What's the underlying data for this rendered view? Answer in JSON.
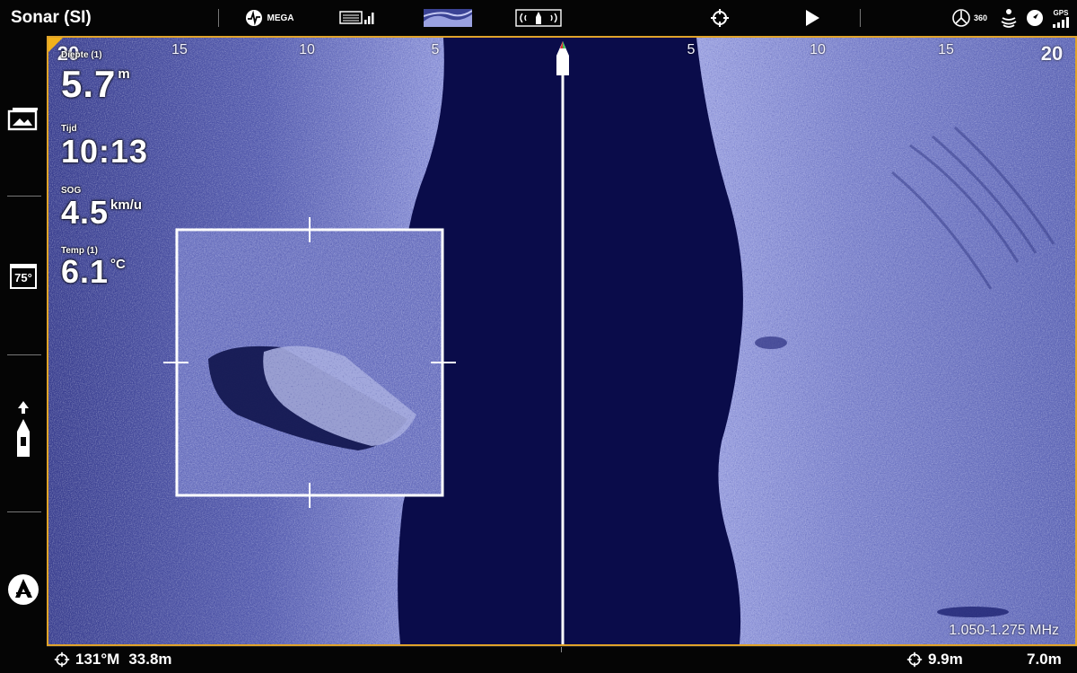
{
  "app": {
    "title": "Sonar (SI)"
  },
  "toolbar": {
    "mega_label": "MEGA",
    "label_360": "360",
    "gps_label": "GPS"
  },
  "range_scale": {
    "left": [
      "20",
      "15",
      "10",
      "5"
    ],
    "right": [
      "5",
      "10",
      "15",
      "20"
    ]
  },
  "readouts": {
    "depth": {
      "label": "Diepte (1)",
      "value": "5.7",
      "unit": "m"
    },
    "time": {
      "label": "Tijd",
      "value": "10:13"
    },
    "sog": {
      "label": "SOG",
      "value": "4.5",
      "unit": "km/u"
    },
    "temp": {
      "label": "Temp (1)",
      "value": "6.1",
      "unit": "°C"
    }
  },
  "sidebar": {
    "temp_icon_text": "75°"
  },
  "sonar": {
    "frequency": "1.050-1.275 MHz"
  },
  "status": {
    "bearing": "131°M",
    "distance": "33.8m",
    "cursor_distance": "9.9m",
    "cursor_depth": "7.0m"
  },
  "colors": {
    "accent_border": "#e0a32a",
    "water_column": "#0a0c4a",
    "bottom_return": "#7f86cf"
  }
}
